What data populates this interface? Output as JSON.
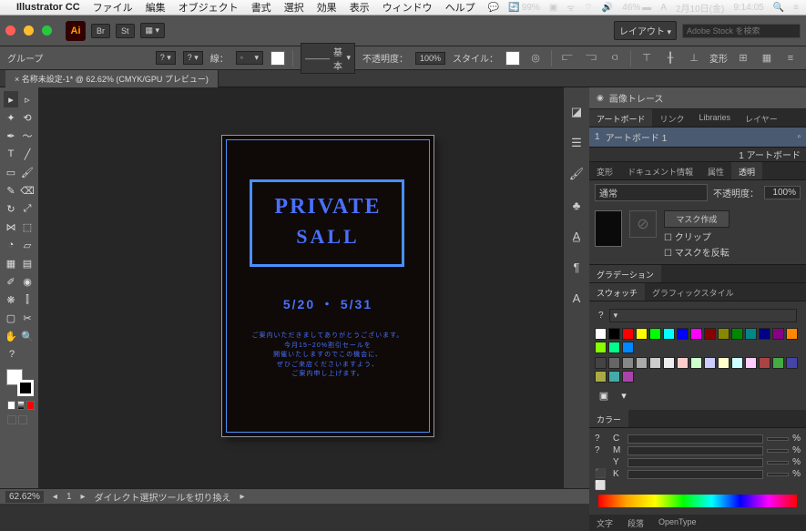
{
  "menubar": {
    "app": "Illustrator CC",
    "items": [
      "ファイル",
      "編集",
      "オブジェクト",
      "書式",
      "選択",
      "効果",
      "表示",
      "ウィンドウ",
      "ヘルプ"
    ],
    "right": {
      "cpu": "99%",
      "battery": "46%",
      "date": "2月10日(金)",
      "time": "9:14:05"
    }
  },
  "controlbar": {
    "br": "Br",
    "st": "St",
    "layout": "レイアウト",
    "search_placeholder": "Adobe Stock を検索"
  },
  "optionbar": {
    "group": "グループ",
    "stroke": "線：",
    "basic": "基本",
    "opacity_lbl": "不透明度：",
    "opacity": "100%",
    "style": "スタイル：",
    "transform": "変形"
  },
  "doc": {
    "tab": "× 名称未設定-1* @ 62.62% (CMYK/GPU プレビュー)"
  },
  "poster": {
    "title": "PRIVATE",
    "sub": "SALL",
    "date": "5/20  ・  5/31",
    "body": "ご案内いただきましてありがとうございます。\n今月15~20%割引セールを\n開催いたしますのでこの機会に、\nぜひご来店くださいますよう、\nご案内申し上げます。"
  },
  "panels": {
    "imgtrace": "画像トレース",
    "tabs1": [
      "アートボード",
      "リンク",
      "Libraries",
      "レイヤー"
    ],
    "artboard_item": "アートボード 1",
    "artboard_count": "1 アートボード",
    "tabs2": [
      "変形",
      "ドキュメント情報",
      "属性",
      "透明"
    ],
    "blend": "通常",
    "opacity_lbl": "不透明度：",
    "opacity": "100%",
    "mask_make": "マスク作成",
    "mask_clip": "クリップ",
    "mask_invert": "マスクを反転",
    "grad": "グラデーション",
    "tabs3": [
      "スウォッチ",
      "グラフィックスタイル"
    ],
    "color": "カラー",
    "cmyk": {
      "c": "C",
      "m": "M",
      "y": "Y",
      "k": "K"
    },
    "footer": [
      "文字",
      "段落",
      "OpenType"
    ]
  },
  "status": {
    "zoom": "62.62%",
    "tool": "ダイレクト選択ツールを切り換え"
  },
  "swatches_colors": [
    [
      "#fff",
      "#000",
      "#f00",
      "#ff0",
      "#0f0",
      "#0ff",
      "#00f",
      "#f0f",
      "#800",
      "#880",
      "#080",
      "#088",
      "#008",
      "#808",
      "#f80",
      "#8f0",
      "#0f8",
      "#08f"
    ],
    [
      "#444",
      "#666",
      "#888",
      "#aaa",
      "#ccc",
      "#eee",
      "#fcc",
      "#cfc",
      "#ccf",
      "#ffc",
      "#cff",
      "#fcf",
      "#a44",
      "#4a4",
      "#44a",
      "#aa4",
      "#4aa",
      "#a4a"
    ]
  ]
}
